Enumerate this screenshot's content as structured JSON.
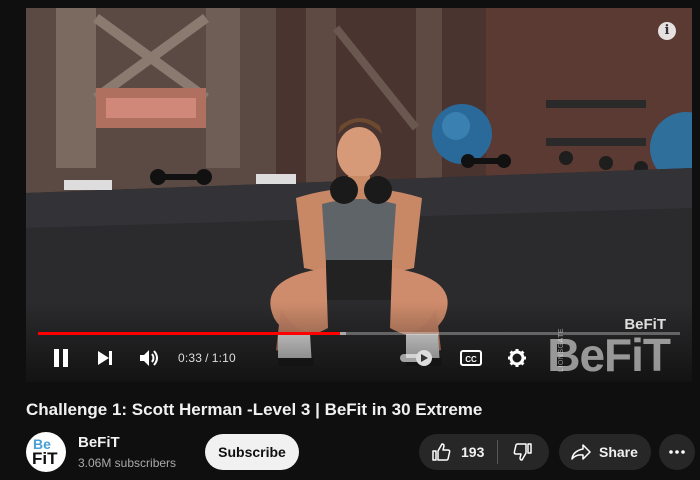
{
  "player": {
    "current_time": "0:33",
    "time_separator": "/",
    "duration": "1:10",
    "progress_fraction": 0.47,
    "buffered_fraction": 0.48,
    "watermark_small": "BeFiT",
    "watermark_big": "BeFiT",
    "watermark_vertical": "LIONSGATE"
  },
  "video": {
    "title": "Challenge 1: Scott Herman -Level 3 | BeFit in 30 Extreme"
  },
  "channel": {
    "name": "BeFiT",
    "subscribers": "3.06M subscribers",
    "avatar_top": "Be",
    "avatar_bottom": "FiT",
    "subscribe_label": "Subscribe"
  },
  "actions": {
    "like_count": "193",
    "share_label": "Share"
  },
  "colors": {
    "background": "#0f0f0f",
    "progress_played": "#ff0000",
    "button_bg": "#272727"
  },
  "icons": [
    "info-icon",
    "pause-icon",
    "next-icon",
    "volume-icon",
    "autoplay-toggle-icon",
    "captions-icon",
    "gear-icon",
    "thumbs-up-icon",
    "thumbs-down-icon",
    "share-icon",
    "more-icon"
  ]
}
